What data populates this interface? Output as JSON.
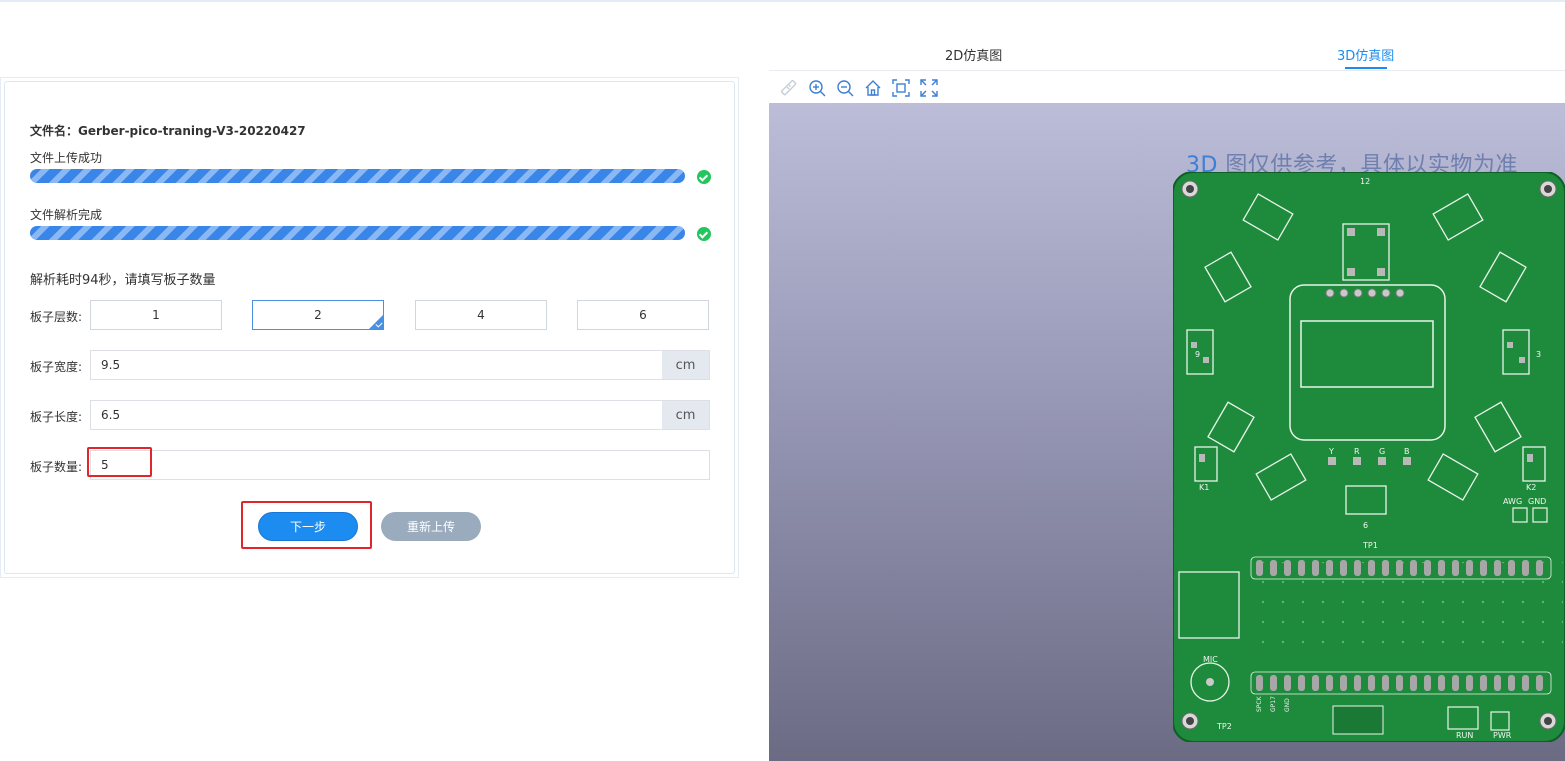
{
  "file": {
    "label": "文件名：",
    "name": "Gerber-pico-traning-V3-20220427"
  },
  "stages": [
    {
      "label": "文件上传成功",
      "progress_percent": 100,
      "status": "success"
    },
    {
      "label": "文件解析完成",
      "progress_percent": 100,
      "status": "success"
    }
  ],
  "parse_info": "解析耗时94秒，请填写板子数量",
  "form": {
    "layers": {
      "label": "板子层数:",
      "options": [
        "1",
        "2",
        "4",
        "6"
      ],
      "selected": "2"
    },
    "width": {
      "label": "板子宽度:",
      "value": "9.5",
      "unit": "cm"
    },
    "length": {
      "label": "板子长度:",
      "value": "6.5",
      "unit": "cm"
    },
    "quantity": {
      "label": "板子数量:",
      "value": "5"
    }
  },
  "buttons": {
    "next": "下一步",
    "reupload": "重新上传"
  },
  "tabs": [
    {
      "label": "2D仿真图",
      "active": false
    },
    {
      "label": "3D仿真图",
      "active": true
    }
  ],
  "toolbar": {
    "icons": [
      "measure-icon",
      "zoom-in-icon",
      "zoom-out-icon",
      "home-icon",
      "fit-screen-icon",
      "fullscreen-icon"
    ]
  },
  "viewer": {
    "note_prefix": "3D",
    "note_text": " 图仅供参考，具体以实物为准",
    "pcb_labels": {
      "top_connector": "12",
      "k1": "K1",
      "k2": "K2",
      "awg": "AWG",
      "gnd": "GND",
      "tp1": "TP1",
      "tp2": "TP2",
      "mic": "MIC",
      "run": "RUN",
      "pwr": "PWR",
      "bottom_center": "6",
      "left_side": "9",
      "right_side": "3",
      "rgb": [
        "Y",
        "R",
        "G",
        "B"
      ],
      "headers": [
        "SPCK",
        "GP17",
        "GND"
      ]
    }
  },
  "colors": {
    "accent": "#1d8cf0",
    "progress": "#3a86e8",
    "success": "#22c55e",
    "highlight": "#e0262b",
    "pcb": "#1e8a3c"
  }
}
